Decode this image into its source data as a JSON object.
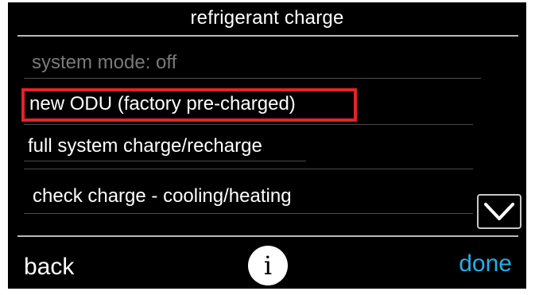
{
  "header": {
    "title": "refrigerant charge"
  },
  "menu": {
    "items": [
      {
        "label": "system mode: off"
      },
      {
        "label": "new ODU (factory pre-charged)"
      },
      {
        "label": "full system charge/recharge"
      },
      {
        "label": "check charge - cooling/heating"
      }
    ]
  },
  "footer": {
    "back_label": "back",
    "info_icon": "i",
    "done_label": "done"
  },
  "colors": {
    "highlight": "#e3232a",
    "done": "#27aee8",
    "background": "#000000",
    "disabled_text": "#7a7a7a"
  },
  "icons": {
    "scroll": "chevron-down-icon",
    "info": "info-icon"
  }
}
